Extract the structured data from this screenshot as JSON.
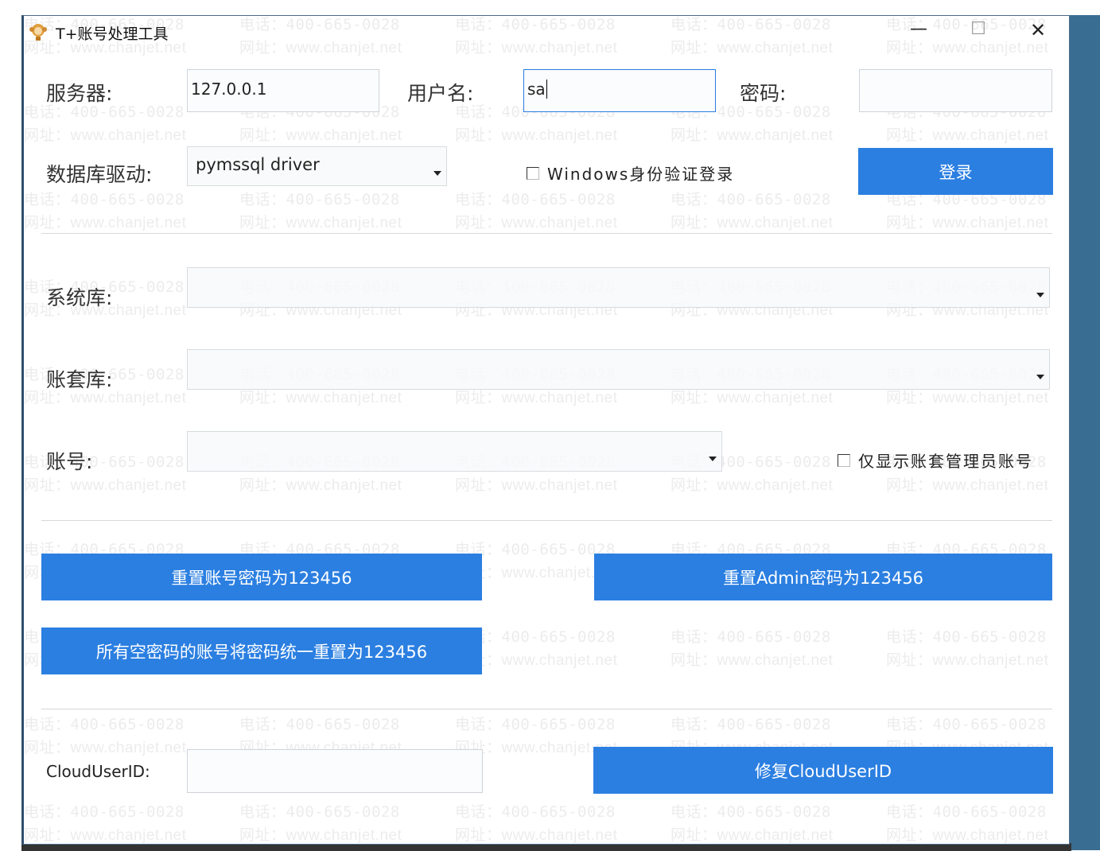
{
  "window": {
    "title": "T+账号处理工具",
    "minimize": "—",
    "maximize": "☐",
    "close": "✕"
  },
  "watermark": {
    "phone": "电话：400-665-0028",
    "site": "网址：www.chanjet.net"
  },
  "login": {
    "server_label": "服务器:",
    "server_value": "127.0.0.1",
    "user_label": "用户名:",
    "user_value": "sa",
    "password_label": "密码:",
    "password_value": "",
    "driver_label": "数据库驱动:",
    "driver_value": "pymssql driver",
    "windows_auth_label": "Windows身份验证登录",
    "windows_auth_checked": false,
    "login_button": "登录"
  },
  "selection": {
    "system_db_label": "系统库:",
    "system_db_value": "",
    "account_set_label": "账套库:",
    "account_set_value": "",
    "account_label": "账号:",
    "account_value": "",
    "admin_only_label": "仅显示账套管理员账号",
    "admin_only_checked": false
  },
  "actions": {
    "reset_account_pwd": "重置账号密码为123456",
    "reset_admin_pwd": "重置Admin密码为123456",
    "reset_empty_pwd": "所有空密码的账号将密码统一重置为123456"
  },
  "cloud": {
    "label": "CloudUserID:",
    "value": "",
    "repair_button": "修复CloudUserID"
  },
  "colors": {
    "accent": "#2b7fe1"
  }
}
